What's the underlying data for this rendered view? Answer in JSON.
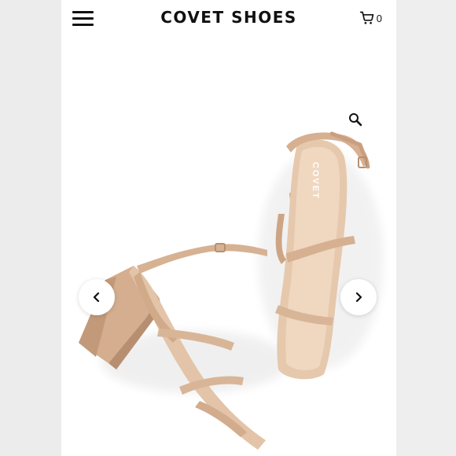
{
  "header": {
    "brand": "COVET SHOES",
    "cart_count": "0"
  },
  "product_image": {
    "sole_brand_text": "COVET",
    "colors": {
      "nude": "#d9b597",
      "nude_dark": "#c49c7b",
      "nude_light": "#ead0b8"
    }
  },
  "icons": {
    "menu": "hamburger-icon",
    "cart": "cart-icon",
    "zoom": "magnifier-icon",
    "prev": "chevron-left-icon",
    "next": "chevron-right-icon"
  }
}
